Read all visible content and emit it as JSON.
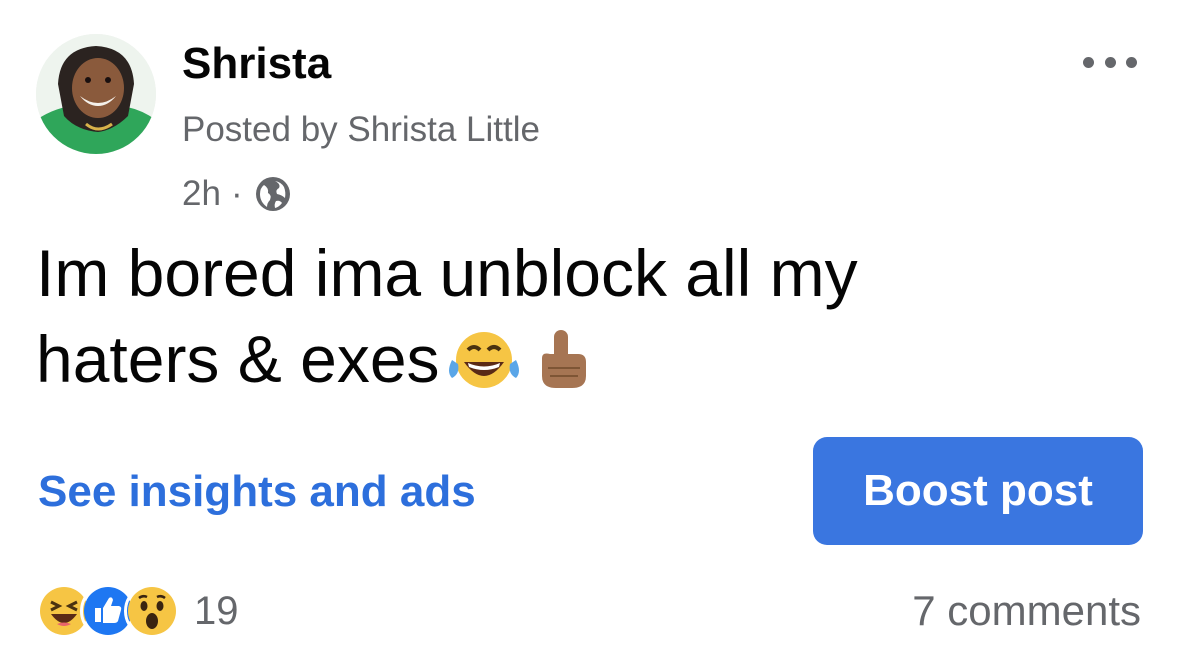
{
  "post": {
    "author": "Shrista",
    "posted_by": "Posted by Shrista Little",
    "time": "2h",
    "separator": "·",
    "privacy_icon": "globe-icon",
    "text_line1": "Im bored ima unblock all my",
    "text_line2": "haters & exes",
    "emojis": [
      "laughing-tears-emoji",
      "pointing-up-emoji"
    ]
  },
  "actions": {
    "insights_label": "See insights and ads",
    "boost_label": "Boost post"
  },
  "footer": {
    "reaction_icons": [
      "haha-reaction-icon",
      "like-reaction-icon",
      "wow-reaction-icon"
    ],
    "reaction_count": "19",
    "comments": "7 comments"
  },
  "colors": {
    "link_blue": "#2d6fdc",
    "button_blue": "#3a76e0",
    "secondary_text": "#65676b"
  }
}
